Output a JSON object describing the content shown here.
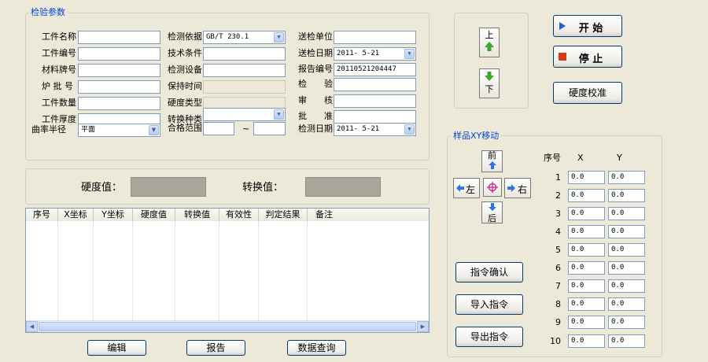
{
  "params": {
    "title": "检验参数",
    "col1": [
      {
        "label": "工件名称",
        "value": ""
      },
      {
        "label": "工件编号",
        "value": ""
      },
      {
        "label": "材料牌号",
        "value": ""
      },
      {
        "label": "炉 批 号",
        "value": ""
      },
      {
        "label": "工件数量",
        "value": ""
      },
      {
        "label": "工件厚度",
        "value": ""
      },
      {
        "label": "曲率半径",
        "value": "平面"
      }
    ],
    "col2": [
      {
        "label": "检测依据",
        "value": "GB/T 230.1"
      },
      {
        "label": "技术条件",
        "value": ""
      },
      {
        "label": "检测设备",
        "value": ""
      },
      {
        "label": "保持时间",
        "value": ""
      },
      {
        "label": "硬度类型",
        "value": ""
      },
      {
        "label": "转换种类",
        "value": ""
      },
      {
        "label": "合格范围",
        "value": ""
      }
    ],
    "range_sep": "~",
    "col3": [
      {
        "label": "送检单位",
        "value": ""
      },
      {
        "label": "送检日期",
        "value": "2011- 5-21"
      },
      {
        "label": "报告编号",
        "value": "20110521204447"
      },
      {
        "label": "检　　验",
        "value": ""
      },
      {
        "label": "审　　核",
        "value": ""
      },
      {
        "label": "批　　准",
        "value": ""
      },
      {
        "label": "检测日期",
        "value": "2011- 5-21"
      }
    ]
  },
  "hardness": {
    "label": "硬度值：",
    "value": ""
  },
  "convert": {
    "label": "转换值：",
    "value": ""
  },
  "table": {
    "headers": [
      "序号",
      "X坐标",
      "Y坐标",
      "硬度值",
      "转换值",
      "有效性",
      "判定结果",
      "备注"
    ]
  },
  "buttons": {
    "edit": "编辑",
    "report": "报告",
    "query": "数据查询",
    "start": "开 始",
    "stop": "停 止",
    "calibrate": "硬度校准",
    "confirm": "指令确认",
    "import": "导入指令",
    "export": "导出指令"
  },
  "updown": {
    "up": "上",
    "down": "下"
  },
  "xy": {
    "title": "样品XY移动",
    "front": "前",
    "back": "后",
    "left": "左",
    "right": "右",
    "col_seq": "序号",
    "col_x": "X",
    "col_y": "Y",
    "rows": [
      {
        "n": "1",
        "x": "0.0",
        "y": "0.0"
      },
      {
        "n": "2",
        "x": "0.0",
        "y": "0.0"
      },
      {
        "n": "3",
        "x": "0.0",
        "y": "0.0"
      },
      {
        "n": "4",
        "x": "0.0",
        "y": "0.0"
      },
      {
        "n": "5",
        "x": "0.0",
        "y": "0.0"
      },
      {
        "n": "6",
        "x": "0.0",
        "y": "0.0"
      },
      {
        "n": "7",
        "x": "0.0",
        "y": "0.0"
      },
      {
        "n": "8",
        "x": "0.0",
        "y": "0.0"
      },
      {
        "n": "9",
        "x": "0.0",
        "y": "0.0"
      },
      {
        "n": "10",
        "x": "0.0",
        "y": "0.0"
      }
    ]
  },
  "colors": {
    "title_blue": "#0046d5",
    "start_icon": "#1b5fd8",
    "stop_icon": "#d93a14",
    "arrow_green": "#3aa82a",
    "arrow_blue": "#2d78d6"
  }
}
